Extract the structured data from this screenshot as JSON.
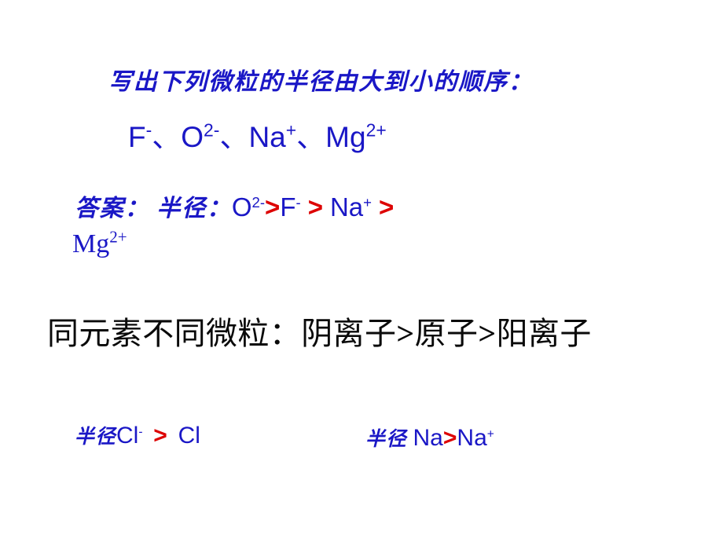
{
  "slide": {
    "background_color": "#FFFFFF",
    "accent_blue": "#1A17C6",
    "accent_red": "#DD0000",
    "text_black": "#0A0A0A"
  },
  "question": {
    "prompt": "写出下列微粒的半径由大到小的顺序：",
    "species_list": {
      "item1_symbol": "F",
      "item1_charge": "-",
      "sep1": "、",
      "item2_symbol": "O",
      "item2_charge": "2-",
      "sep2": "、",
      "item3_symbol": "Na",
      "item3_charge": "+",
      "sep3": "、",
      "item4_symbol": "Mg",
      "item4_charge": "2+"
    }
  },
  "answer": {
    "label": "答案：",
    "property": "半径：",
    "term1_symbol": "O",
    "term1_charge": "2-",
    "gt1": ">",
    "term2_symbol": "F",
    "term2_charge": "-",
    "gt2": ">",
    "term3_symbol": "Na",
    "term3_charge": "+",
    "gt3": ">",
    "term4_symbol": "Mg",
    "term4_charge": "2+"
  },
  "rule": {
    "prefix": "同元素不同微粒：",
    "anion": "阴离子",
    "gt1": ">",
    "atom": "原子",
    "gt2": ">",
    "cation": "阳离子"
  },
  "examples": {
    "left": {
      "label": "半径",
      "term1_symbol": "Cl",
      "term1_charge": "-",
      "gt": ">",
      "term2_symbol": "Cl"
    },
    "right": {
      "label": "半径",
      "term1_symbol": "Na",
      "gt": ">",
      "term2_symbol": "Na",
      "term2_charge": "+"
    }
  }
}
